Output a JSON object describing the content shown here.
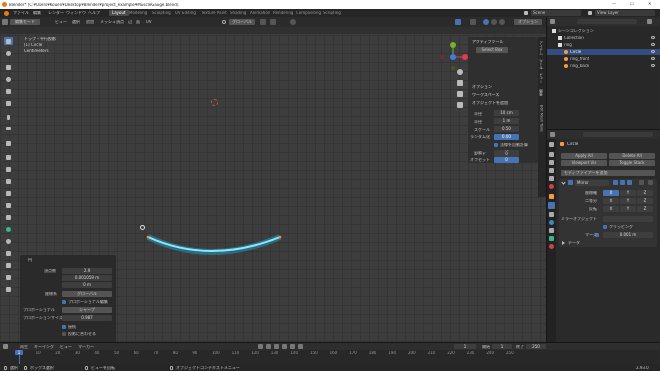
{
  "titlebar": {
    "title": "Blender* [C:¥Users¥Kouen¥Desktop¥Blender¥project_example¥MuscleGauge.blend]",
    "controls": [
      "—",
      "☐",
      "✕"
    ]
  },
  "menubar": {
    "menus": [
      "ファイル",
      "編集",
      "レンダー",
      "ウィンドウ",
      "ヘルプ"
    ],
    "workspaces": [
      "Layout",
      "Modeling",
      "Sculpting",
      "UV Editing",
      "Texture Paint",
      "Shading",
      "Animation",
      "Rendering",
      "Compositing",
      "Scripting"
    ],
    "active_workspace": "Layout",
    "scene": "Scene",
    "view_layer": "View Layer"
  },
  "viewport_header": {
    "mode": "編集モード",
    "menus": [
      "ビュー",
      "選択",
      "追加",
      "メッシュ",
      "頂点",
      "辺",
      "面",
      "UV"
    ],
    "transform_orientation": "グローバル",
    "options_label": "オプション"
  },
  "viewport": {
    "view_name": "トップ・平行投影",
    "object_info": "(1) Circle",
    "units": "Centimeters"
  },
  "npanel": {
    "tabs": [
      "アイテム",
      "ツール",
      "ビュー",
      "編集",
      "Edit Mesh Tools"
    ],
    "sections": [
      {
        "label": "アクティブツール",
        "expanded": true
      },
      {
        "label": "オプション",
        "expanded": false
      },
      {
        "label": "ワークスペース",
        "expanded": false
      },
      {
        "label": "オブジェクトを追加",
        "expanded": true
      }
    ],
    "select_box": "Select Box",
    "fields": [
      {
        "label": "半径",
        "value": "10 cm"
      },
      {
        "label": "半径",
        "value": "1 m"
      },
      {
        "label": "スケール",
        "value": "0.50"
      },
      {
        "label": "ランダム化",
        "value": "0.00"
      }
    ],
    "checkbox_label": "法線を自動計算",
    "fields2": [
      {
        "label": "分割",
        "value": "40"
      },
      {
        "label": "オフセット",
        "value": "0"
      },
      {
        "label": "シード",
        "value": "0"
      }
    ]
  },
  "outliner": {
    "search_placeholder": "",
    "items": [
      {
        "label": "シーンコレクション",
        "depth": 0
      },
      {
        "label": "Collection",
        "depth": 1
      },
      {
        "label": "ring",
        "depth": 1
      },
      {
        "label": "Circle",
        "depth": 2
      },
      {
        "label": "ring_front",
        "depth": 2
      },
      {
        "label": "ring_back",
        "depth": 2
      }
    ]
  },
  "properties": {
    "object_name": "Circle",
    "buttons": [
      "Apply All",
      "Delete All",
      "Viewport Vis",
      "Toggle Stack"
    ],
    "add_modifier_label": "モディファイアーを追加",
    "modifier_name": "Mirror",
    "axis_header": [
      "",
      "X",
      "Y",
      "Z"
    ],
    "rows": [
      {
        "label": "座標軸",
        "cells": [
          "X",
          "Y",
          "Z"
        ]
      },
      {
        "label": "二等分",
        "cells": [
          "X",
          "Y",
          "Z"
        ]
      },
      {
        "label": "反転",
        "cells": [
          "X",
          "Y",
          "Z"
        ]
      }
    ],
    "mirror_object_label": "ミラーオブジェクト",
    "clipping_label": "クリッピング",
    "merge_label": "マージ",
    "merge_value": "0.001 m",
    "data_label": "データ"
  },
  "operator_panel": {
    "title": "円",
    "fields": [
      {
        "label": "頂点数",
        "value": "2.9"
      },
      {
        "label": "",
        "value": "0.001059 m"
      },
      {
        "label": "",
        "value": "0 m"
      }
    ],
    "orientation_label": "座標系",
    "orientation_value": "グローバル",
    "proportional_label": "プロポーショナル編集",
    "falloff_label": "プロポーショナル",
    "falloff_value": "シャープ",
    "size_label": "プロポーションサイズ",
    "size_value": "0.987",
    "checks": [
      "接続",
      "投影に合わせる"
    ]
  },
  "timeline": {
    "menus": [
      "再生",
      "キーイング",
      "ビュー",
      "マーカー"
    ],
    "current_frame": "1",
    "start_label": "開始",
    "start": "1",
    "end_label": "終了",
    "end": "250",
    "ticks": [
      "0",
      "10",
      "20",
      "30",
      "40",
      "50",
      "60",
      "70",
      "80",
      "90",
      "100",
      "110",
      "120",
      "130",
      "140",
      "150",
      "160",
      "170",
      "180",
      "190",
      "200",
      "210",
      "220",
      "230",
      "240",
      "250"
    ]
  },
  "statusbar": {
    "items": [
      "選択",
      "ボックス選択",
      "ビューを回転",
      "オブジェクトコンテキストメニュー"
    ],
    "version": "2.93.0"
  },
  "colors": {
    "accent": "#4772b3",
    "curve_glow": "#1ec8ff",
    "vertex_orange": "#ff8c2a",
    "axis_x": "#e23a4f",
    "axis_y": "#75b12f",
    "axis_z": "#3c7de0"
  }
}
